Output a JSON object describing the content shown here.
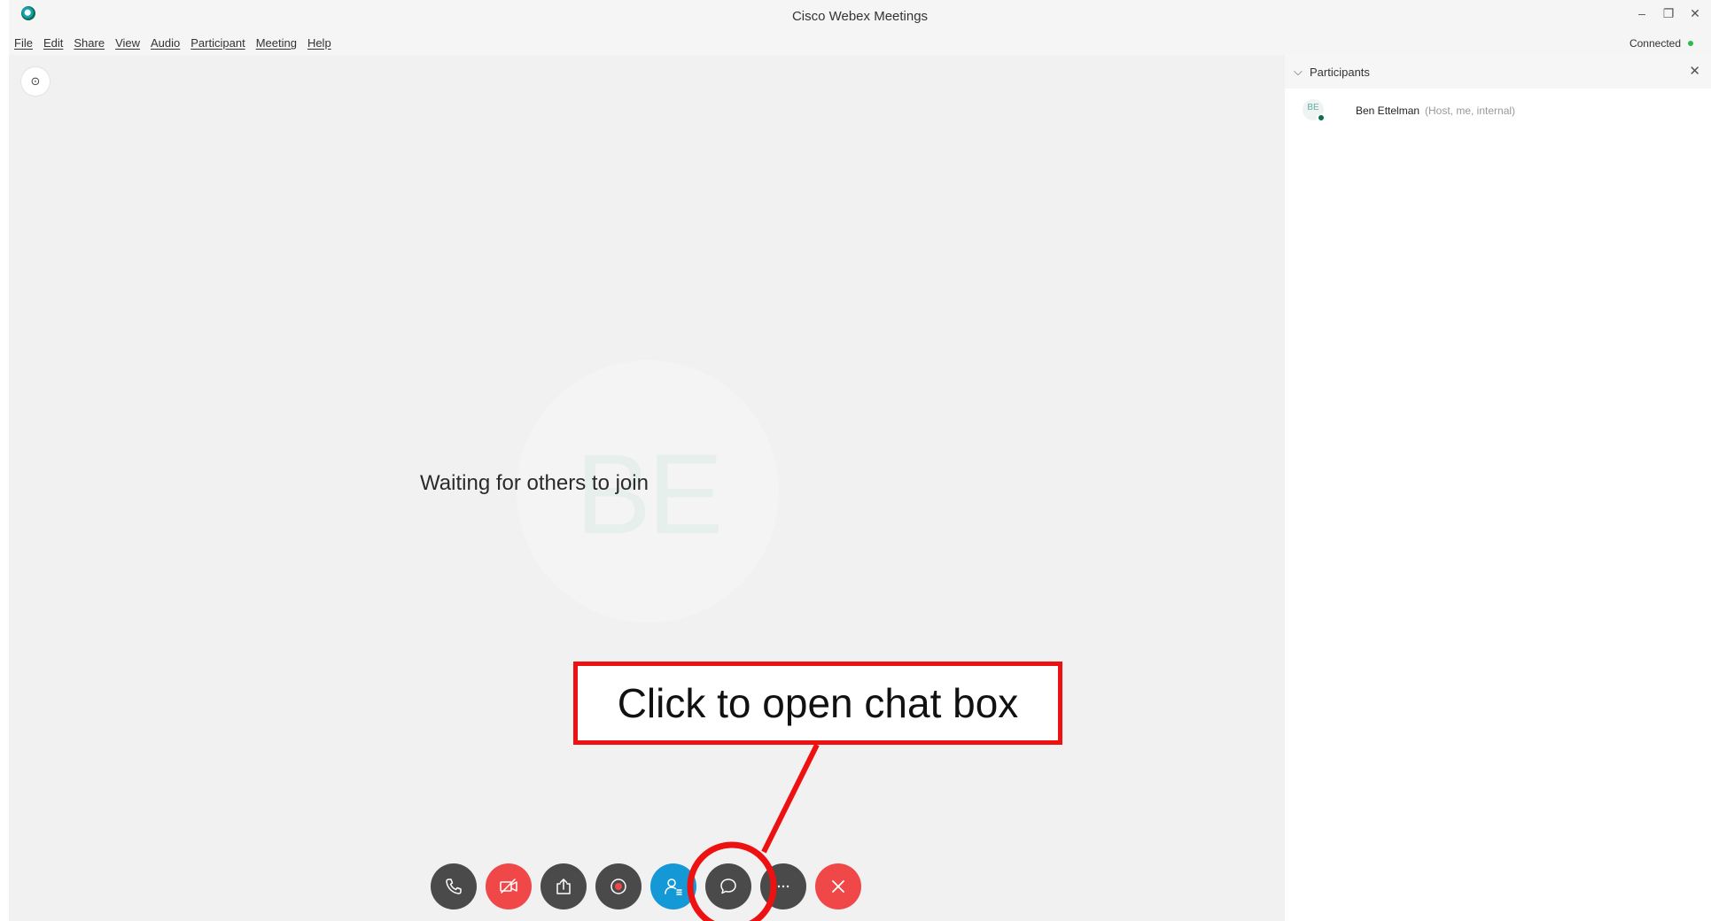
{
  "window": {
    "title": "Cisco Webex Meetings",
    "controls": {
      "minimize": "–",
      "restore": "❐",
      "close": "✕"
    }
  },
  "menu": {
    "items": [
      "File",
      "Edit",
      "Share",
      "View",
      "Audio",
      "Participant",
      "Meeting",
      "Help"
    ],
    "status": "Connected",
    "status_color": "#2bbd4c"
  },
  "stage": {
    "info_icon": "⊙",
    "avatar_initials": "BE",
    "waiting_text": "Waiting for others to join"
  },
  "controls": [
    {
      "name": "audio-button",
      "icon": "phone-icon"
    },
    {
      "name": "video-button",
      "icon": "video-off-icon"
    },
    {
      "name": "share-button",
      "icon": "share-icon"
    },
    {
      "name": "record-button",
      "icon": "record-icon"
    },
    {
      "name": "participants-button",
      "icon": "participants-icon"
    },
    {
      "name": "chat-button",
      "icon": "chat-icon"
    },
    {
      "name": "more-button",
      "icon": "more-icon"
    },
    {
      "name": "leave-button",
      "icon": "close-icon"
    }
  ],
  "participants_panel": {
    "title": "Participants",
    "close": "✕",
    "chevron": "⌵",
    "participants": [
      {
        "initials": "BE",
        "name": "Ben Ettelman",
        "role": "(Host, me, internal)"
      }
    ]
  },
  "annotation": {
    "text": "Click to open chat box",
    "color": "#ee1111"
  },
  "colors": {
    "accent_blue": "#1598d6",
    "danger_red": "#f04848",
    "control_dark": "#4a4a4a",
    "brand_green": "#0b6e4f"
  }
}
